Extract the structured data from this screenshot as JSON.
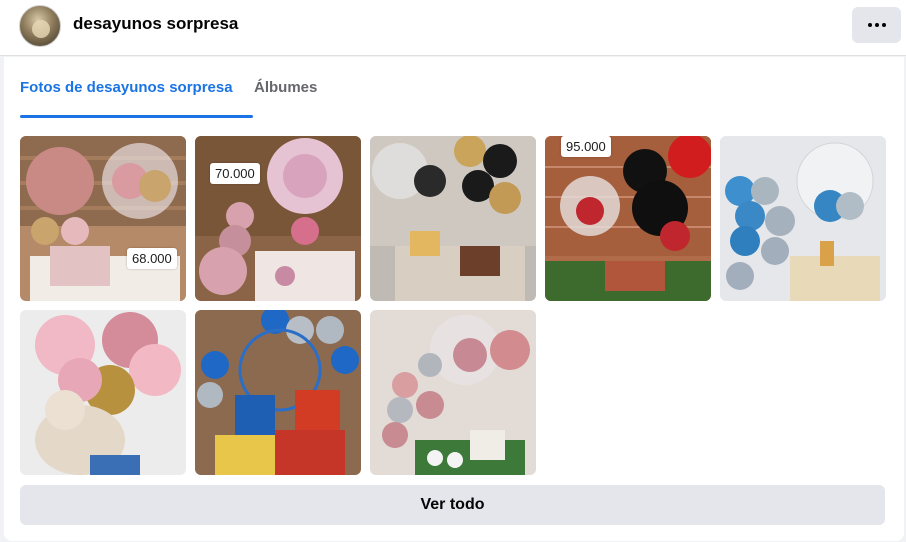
{
  "header": {
    "page_name": "desayunos sorpresa",
    "more_icon": "more-horizontal-icon"
  },
  "tabs": [
    {
      "label": "Fotos de desayunos sorpresa",
      "active": true
    },
    {
      "label": "Álbumes",
      "active": false
    }
  ],
  "photos": [
    {
      "price": "68.000"
    },
    {
      "price": "70.000"
    },
    {
      "price": ""
    },
    {
      "price": "95.000"
    },
    {
      "price": ""
    },
    {
      "price": ""
    },
    {
      "price": ""
    },
    {
      "price": ""
    }
  ],
  "see_all_label": "Ver todo",
  "colors": {
    "accent": "#1b74e4",
    "button_bg": "#e4e6eb",
    "page_bg": "#f0f2f5"
  }
}
